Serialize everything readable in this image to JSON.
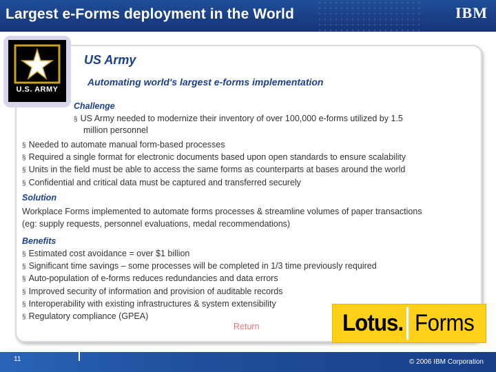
{
  "header": {
    "title": "Largest e-Forms deployment in the World",
    "logo_text": "IBM"
  },
  "army_logo": {
    "text": "U.S. ARMY"
  },
  "org_name": "US Army",
  "subtitle": "Automating world's largest e-forms implementation",
  "challenge": {
    "label": "Challenge",
    "first_bullet": "US Army needed to modernize their inventory of over 100,000 e-forms utilized by 1.5",
    "first_bullet_cont": "million personnel",
    "bullets": [
      "Needed to automate manual form-based processes",
      "Required a single format for electronic documents based upon open standards to ensure scalability",
      "Units in the field must be able to access the same forms as counterparts at bases around the world",
      "Confidential and critical data must be captured and transferred securely"
    ]
  },
  "solution": {
    "label": "Solution",
    "line1": "Workplace Forms implemented to automate forms processes & streamline volumes of paper transactions",
    "line2": "(eg: supply requests, personnel evaluations, medal recommendations)"
  },
  "benefits": {
    "label": "Benefits",
    "bullets": [
      "Estimated cost avoidance = over $1 billion",
      "Significant time savings – some processes will be completed in 1/3 time previously required",
      "Auto-population of e-forms reduces redundancies and data errors",
      "Improved security of information and provision of auditable records",
      "Interoperability with existing infrastructures & system extensibility",
      "Regulatory compliance (GPEA)"
    ]
  },
  "return_link": "Return",
  "product_logo": {
    "word1": "Lotus.",
    "word2": "Forms"
  },
  "footer": {
    "page_number": "11",
    "copyright": "© 2006 IBM Corporation"
  },
  "colors": {
    "header_blue": "#1a3f86",
    "heading_blue": "#1c3f8c",
    "lotus_yellow": "#ffd11a",
    "return_link": "#e07a7a"
  }
}
